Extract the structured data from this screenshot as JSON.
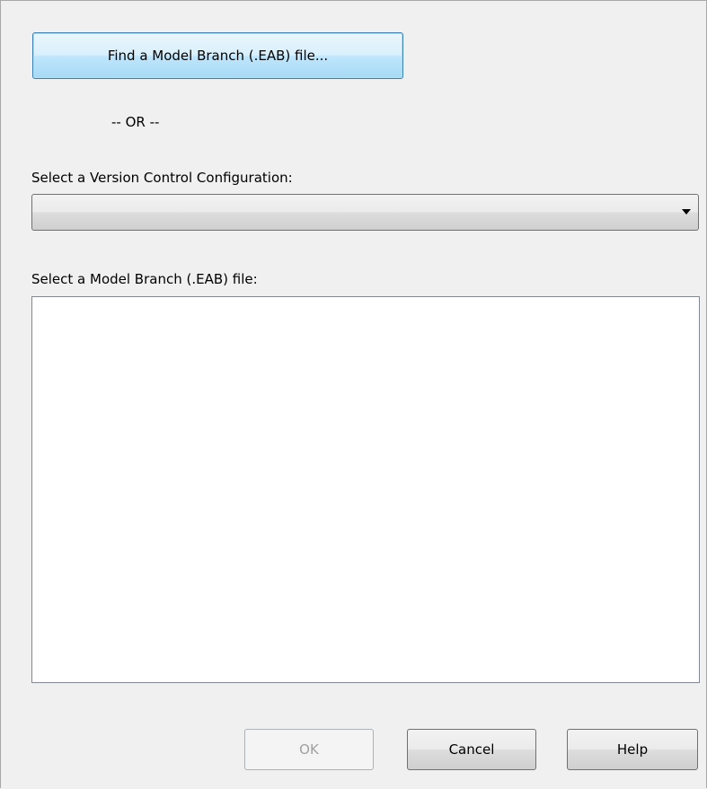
{
  "find_button": {
    "label": "Find a Model Branch (.EAB) file..."
  },
  "separator": {
    "text": "-- OR --"
  },
  "version_control": {
    "label": "Select a Version Control Configuration:",
    "selected_value": ""
  },
  "model_branch": {
    "label": "Select a Model Branch (.EAB) file:",
    "items": []
  },
  "buttons": {
    "ok": "OK",
    "cancel": "Cancel",
    "help": "Help"
  }
}
